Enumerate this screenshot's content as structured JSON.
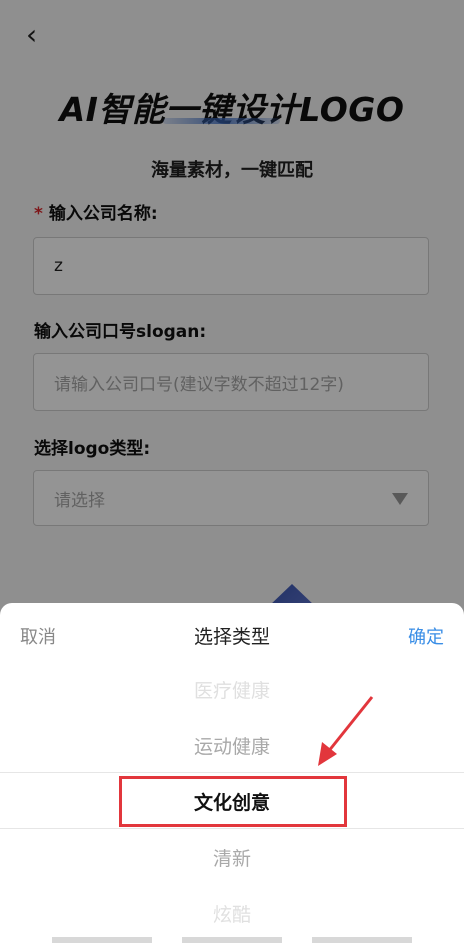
{
  "header": {
    "title": "AI智能一键设计LOGO",
    "subtitle": "海量素材，一键匹配"
  },
  "form": {
    "company_name": {
      "required_mark": "*",
      "label": "输入公司名称:",
      "value": "z"
    },
    "slogan": {
      "label": "输入公司口号slogan:",
      "placeholder": "请输入公司口号(建议字数不超过12字)"
    },
    "logo_type": {
      "label": "选择logo类型:",
      "placeholder": "请选择"
    }
  },
  "picker": {
    "cancel_label": "取消",
    "title": "选择类型",
    "confirm_label": "确定",
    "options": [
      "医疗健康",
      "运动健康",
      "文化创意",
      "清新",
      "炫酷"
    ],
    "selected": "文化创意"
  },
  "colors": {
    "accent": "#3a8ee6",
    "required": "#d9262b",
    "annotation": "#e2363c"
  },
  "icons": {
    "back": "chevron-left-icon",
    "dropdown": "triangle-down-icon"
  }
}
